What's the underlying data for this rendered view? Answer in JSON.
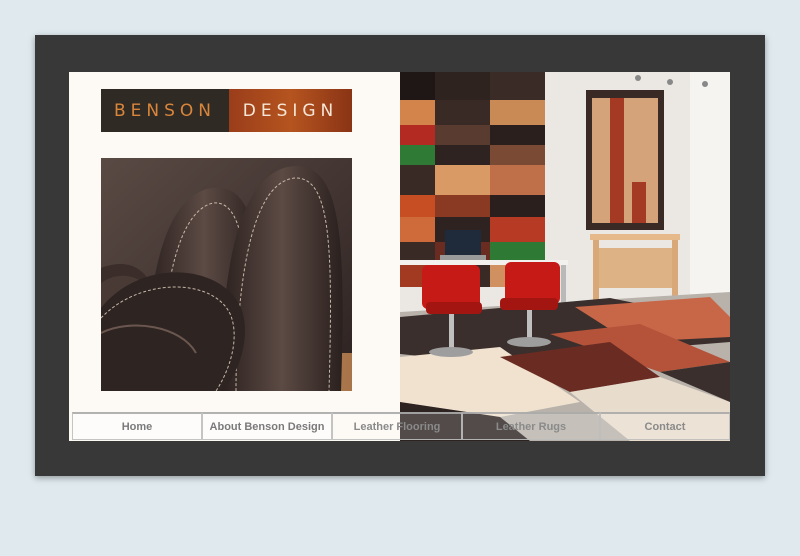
{
  "brand": {
    "logo_left": "BENSON",
    "logo_right": "DESIGN",
    "colors": {
      "frame": "#383838",
      "page_bg": "#dfe9ee",
      "panel": "#fdf9f5",
      "logo_dark": "#302a25",
      "logo_rust": "#b5541f",
      "logo_text_orange": "#d9853a"
    }
  },
  "images": {
    "leather_roll": "rolled-leather-photo",
    "showroom": "leather-showroom-photo"
  },
  "nav": {
    "items": [
      {
        "label": "Home"
      },
      {
        "label": "About Benson Design"
      },
      {
        "label": "Leather Flooring"
      },
      {
        "label": "Leather Rugs"
      },
      {
        "label": "Contact"
      }
    ]
  }
}
